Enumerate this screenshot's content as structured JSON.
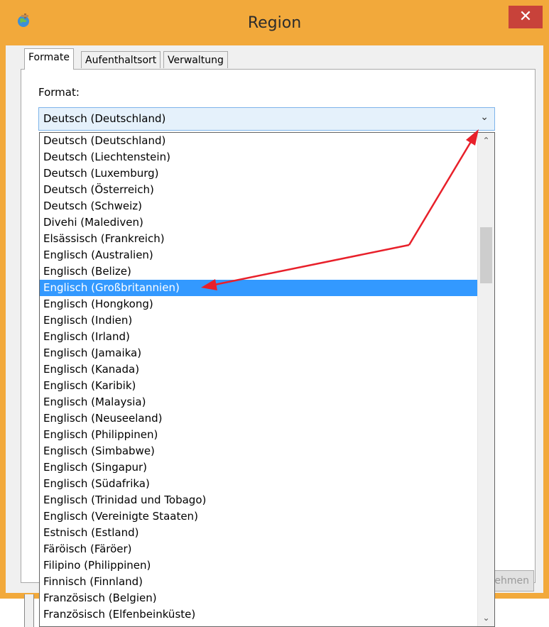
{
  "window": {
    "title": "Region",
    "close_symbol": "✕"
  },
  "tabs": [
    {
      "label": "Formate",
      "active": true
    },
    {
      "label": "Aufenthaltsort",
      "active": false
    },
    {
      "label": "Verwaltung",
      "active": false
    }
  ],
  "format": {
    "label": "Format:",
    "selected_value": "Deutsch (Deutschland)"
  },
  "apply_button_partial": "ehmen",
  "dropdown": {
    "items": [
      "Deutsch (Deutschland)",
      "Deutsch (Liechtenstein)",
      "Deutsch (Luxemburg)",
      "Deutsch (Österreich)",
      "Deutsch (Schweiz)",
      "Divehi (Malediven)",
      "Elsässisch (Frankreich)",
      "Englisch (Australien)",
      "Englisch (Belize)",
      "Englisch (Großbritannien)",
      "Englisch (Hongkong)",
      "Englisch (Indien)",
      "Englisch (Irland)",
      "Englisch (Jamaika)",
      "Englisch (Kanada)",
      "Englisch (Karibik)",
      "Englisch (Malaysia)",
      "Englisch (Neuseeland)",
      "Englisch (Philippinen)",
      "Englisch (Simbabwe)",
      "Englisch (Singapur)",
      "Englisch (Südafrika)",
      "Englisch (Trinidad und Tobago)",
      "Englisch (Vereinigte Staaten)",
      "Estnisch (Estland)",
      "Färöisch (Färöer)",
      "Filipino (Philippinen)",
      "Finnisch (Finnland)",
      "Französisch (Belgien)",
      "Französisch (Elfenbeinküste)"
    ],
    "highlighted_index": 9
  },
  "icons": {
    "app": "globe-region-icon",
    "close": "close-icon",
    "combo_arrow": "chevron-down-icon",
    "scroll_up": "chevron-up-icon",
    "scroll_down": "chevron-down-icon"
  },
  "colors": {
    "title_bar": "#f2a93b",
    "close_button": "#c8423a",
    "selection": "#3399ff",
    "annotation_arrow": "#e8202a"
  }
}
